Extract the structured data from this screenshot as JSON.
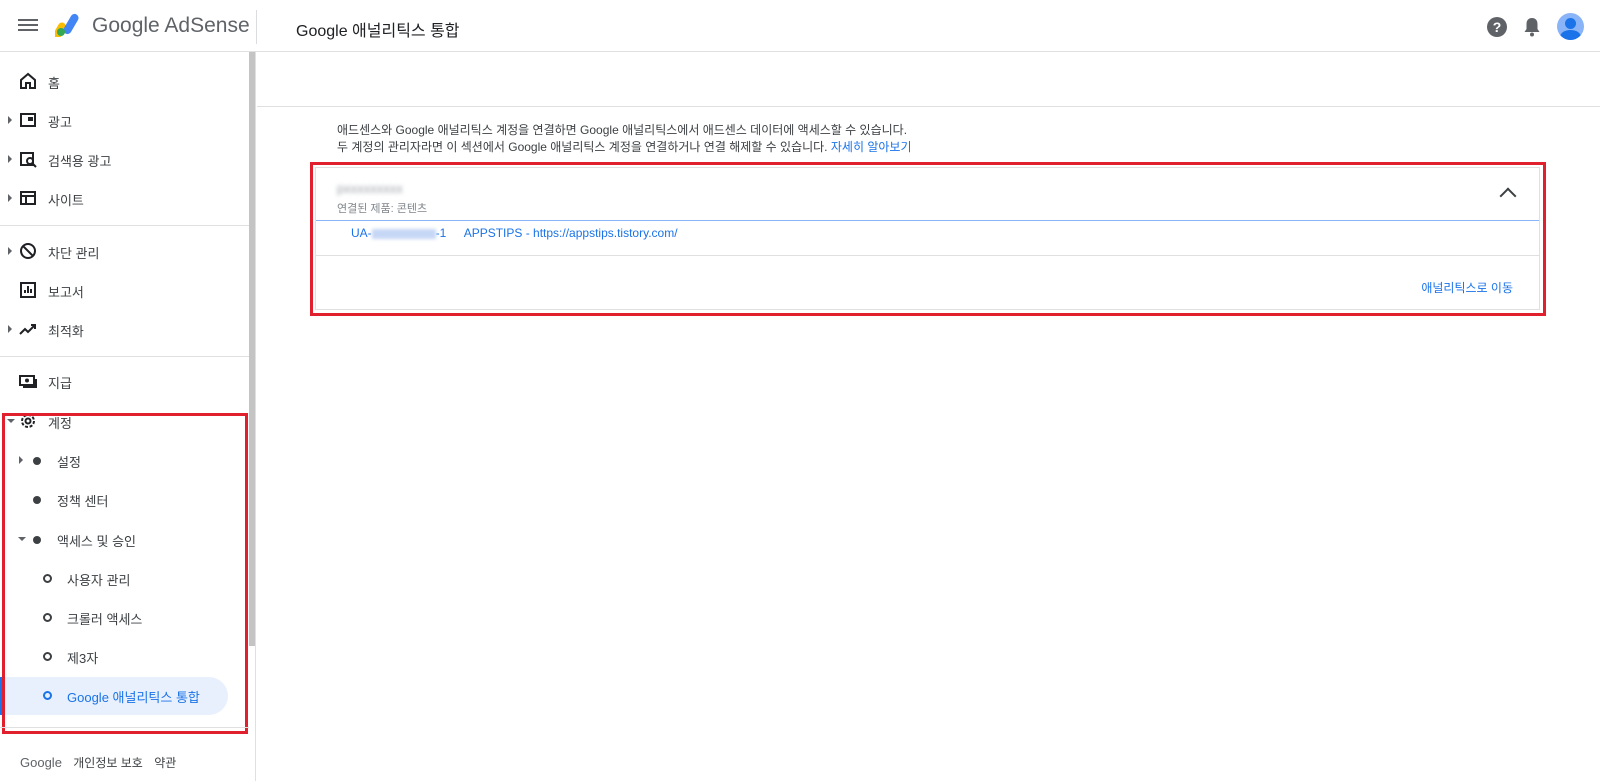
{
  "brand": {
    "prefix": "Google",
    "name": "AdSense"
  },
  "header": {
    "page_title": "Google 애널리틱스 통합",
    "help_glyph": "?"
  },
  "sidebar": {
    "items": [
      {
        "label": "홈",
        "icon": "home-icon"
      },
      {
        "label": "광고",
        "icon": "ads-icon"
      },
      {
        "label": "검색용 광고",
        "icon": "search-ads-icon"
      },
      {
        "label": "사이트",
        "icon": "sites-icon"
      },
      {
        "label": "차단 관리",
        "icon": "block-icon"
      },
      {
        "label": "보고서",
        "icon": "reports-icon"
      },
      {
        "label": "최적화",
        "icon": "optimization-icon"
      },
      {
        "label": "지급",
        "icon": "payments-icon"
      },
      {
        "label": "계정",
        "icon": "gear-icon"
      },
      {
        "label": "설정"
      },
      {
        "label": "정책 센터"
      },
      {
        "label": "액세스 및 승인"
      },
      {
        "label": "사용자 관리"
      },
      {
        "label": "크롤러 액세스"
      },
      {
        "label": "제3자"
      },
      {
        "label": "Google 애널리틱스 통합"
      }
    ]
  },
  "footer": {
    "google": "Google",
    "privacy": "개인정보 보호",
    "terms": "약관"
  },
  "main": {
    "description_line1": "애드센스와 Google 애널리틱스 계정을 연결하면 Google 애널리틱스에서 애드센스 데이터에 액세스할 수 있습니다.",
    "description_line2": "두 계정의 관리자라면 이 섹션에서 Google 애널리틱스 계정을 연결하거나 연결 해제할 수 있습니다.",
    "learn_more": "자세히 알아보기",
    "card": {
      "account_name": "pxxxxxxxxx",
      "linked_product": "연결된 제품: 콘텐츠",
      "property_prefix": "UA-",
      "property_suffix": "-1",
      "property_name": "APPSTIPS - https://appstips.tistory.com/",
      "go_link": "애널리틱스로 이동"
    }
  },
  "colors": {
    "accent": "#1a73e8",
    "highlight": "#e0202c",
    "active_bg": "#e8f0fe"
  }
}
